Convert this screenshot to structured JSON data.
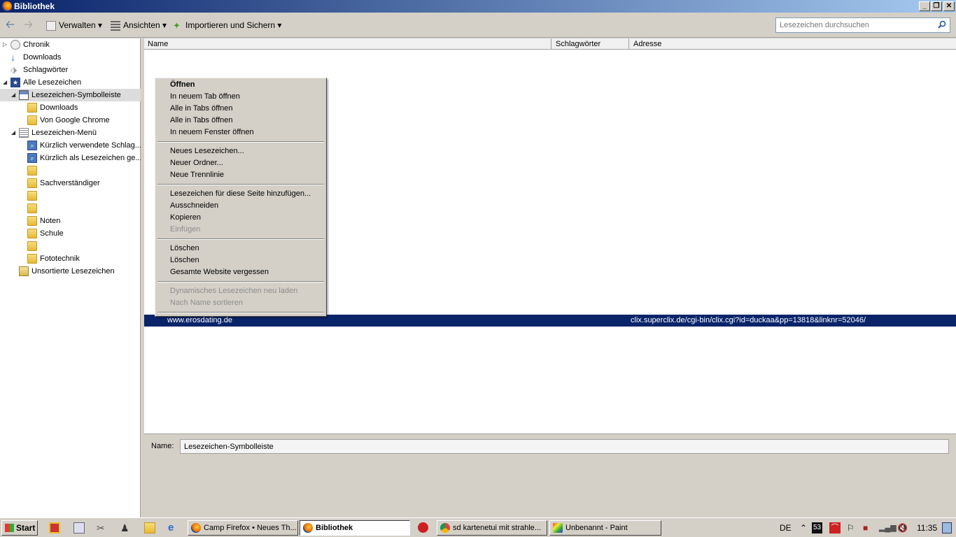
{
  "window": {
    "title": "Bibliothek"
  },
  "toolbar": {
    "manage_label": "Verwalten",
    "views_label": "Ansichten",
    "import_label": "Importieren und Sichern",
    "search_placeholder": "Lesezeichen durchsuchen"
  },
  "sidebar": {
    "items": [
      {
        "label": "Chronik"
      },
      {
        "label": "Downloads"
      },
      {
        "label": "Schlagwörter"
      },
      {
        "label": "Alle Lesezeichen"
      },
      {
        "label": "Lesezeichen-Symbolleiste"
      },
      {
        "label": "Downloads"
      },
      {
        "label": "Von Google Chrome"
      },
      {
        "label": "Lesezeichen-Menü"
      },
      {
        "label": "Kürzlich verwendete Schlag..."
      },
      {
        "label": "Kürzlich als Lesezeichen ge..."
      },
      {
        "label": ""
      },
      {
        "label": "Sachverständiger"
      },
      {
        "label": ""
      },
      {
        "label": ""
      },
      {
        "label": "Noten"
      },
      {
        "label": "Schule"
      },
      {
        "label": ""
      },
      {
        "label": "Fototechnik"
      },
      {
        "label": "Unsortierte Lesezeichen"
      }
    ]
  },
  "columns": {
    "name": "Name",
    "tags": "Schlagwörter",
    "address": "Adresse"
  },
  "selected_row": {
    "name": "www.erosdating.de",
    "address": "clix.superclix.de/cgi-bin/clix.cgi?id=duckaa&pp=13818&linknr=52046/"
  },
  "context_menu": {
    "items": [
      {
        "label": "Öffnen"
      },
      {
        "label": "In neuem Tab öffnen"
      },
      {
        "label": "Alle in Tabs öffnen"
      },
      {
        "label": "Alle in Tabs öffnen"
      },
      {
        "label": "In neuem Fenster öffnen"
      },
      {
        "label": "Neues Lesezeichen..."
      },
      {
        "label": "Neuer Ordner..."
      },
      {
        "label": "Neue Trennlinie"
      },
      {
        "label": "Lesezeichen für diese Seite hinzufügen..."
      },
      {
        "label": "Ausschneiden"
      },
      {
        "label": "Kopieren"
      },
      {
        "label": "Einfügen"
      },
      {
        "label": "Löschen"
      },
      {
        "label": "Löschen"
      },
      {
        "label": "Gesamte Website vergessen"
      },
      {
        "label": "Dynamisches Lesezeichen neu laden"
      },
      {
        "label": "Nach Name sortieren"
      }
    ]
  },
  "details": {
    "name_label": "Name:",
    "name_value": "Lesezeichen-Symbolleiste"
  },
  "taskbar": {
    "start_label": "Start",
    "tasks": [
      {
        "label": "Camp Firefox • Neues Th..."
      },
      {
        "label": "Bibliothek"
      },
      {
        "label": "sd kartenetui mit strahle..."
      },
      {
        "label": "Unbenannt - Paint"
      }
    ],
    "language": "DE",
    "tray_badge": "53",
    "clock": "11:35"
  },
  "colors": {
    "selection": "#0a246a",
    "titlebar": "#0a246a"
  }
}
